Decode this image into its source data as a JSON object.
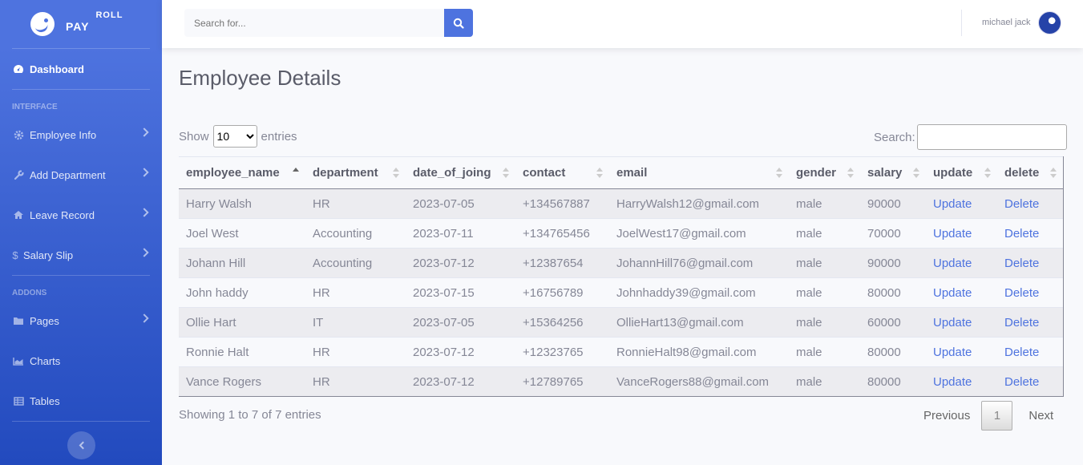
{
  "brand": {
    "word1": "PAY",
    "word2": "ROLL"
  },
  "sidebar": {
    "dashboard": "Dashboard",
    "heading_interface": "INTERFACE",
    "heading_addons": "ADDONS",
    "items": [
      {
        "label": "Employee Info",
        "icon": "gear-icon"
      },
      {
        "label": "Add Department",
        "icon": "wrench-icon"
      },
      {
        "label": "Leave Record",
        "icon": "home-icon"
      },
      {
        "label": "Salary Slip",
        "icon": "dollar-icon"
      },
      {
        "label": "Pages",
        "icon": "folder-icon"
      },
      {
        "label": "Charts",
        "icon": "chart-area-icon"
      },
      {
        "label": "Tables",
        "icon": "table-icon"
      }
    ]
  },
  "topbar": {
    "search_placeholder": "Search for...",
    "username": "michael jack"
  },
  "main": {
    "title": "Employee Details",
    "show_label": "Show",
    "entries_label": "entries",
    "page_length": "10",
    "search_label": "Search:",
    "columns": [
      "employee_name",
      "department",
      "date_of_joing",
      "contact",
      "email",
      "gender",
      "salary",
      "update",
      "delete"
    ],
    "rows": [
      [
        "Harry Walsh",
        "HR",
        "2023-07-05",
        "+134567887",
        "HarryWalsh12@gmail.com",
        "male",
        "90000",
        "Update",
        "Delete"
      ],
      [
        "Joel West",
        "Accounting",
        "2023-07-11",
        "+134765456",
        "JoelWest17@gmail.com",
        "male",
        "70000",
        "Update",
        "Delete"
      ],
      [
        "Johann Hill",
        "Accounting",
        "2023-07-12",
        "+12387654",
        "JohannHill76@gmail.com",
        "male",
        "90000",
        "Update",
        "Delete"
      ],
      [
        "John haddy",
        "HR",
        "2023-07-15",
        "+16756789",
        "Johnhaddy39@gmail.com",
        "male",
        "80000",
        "Update",
        "Delete"
      ],
      [
        "Ollie Hart",
        "IT",
        "2023-07-05",
        "+15364256",
        "OllieHart13@gmail.com",
        "male",
        "60000",
        "Update",
        "Delete"
      ],
      [
        "Ronnie Halt",
        "HR",
        "2023-07-12",
        "+12323765",
        "RonnieHalt98@gmail.com",
        "male",
        "80000",
        "Update",
        "Delete"
      ],
      [
        "Vance Rogers",
        "HR",
        "2023-07-12",
        "+12789765",
        "VanceRogers88@gmail.com",
        "male",
        "80000",
        "Update",
        "Delete"
      ]
    ],
    "info": "Showing 1 to 7 of 7 entries",
    "pager": {
      "prev": "Previous",
      "page": "1",
      "next": "Next"
    }
  },
  "colors": {
    "primary": "#4e73df",
    "text": "#858796",
    "heading": "#5a5c69"
  }
}
